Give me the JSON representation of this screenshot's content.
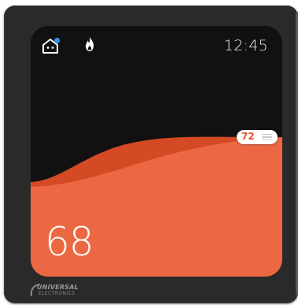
{
  "status_bar": {
    "time": "12:45",
    "home_icon": "home-robot-icon",
    "home_status_dot_color": "#2f8fe6",
    "mode_icon": "flame-icon"
  },
  "thermostat": {
    "current_temperature": "68",
    "setpoint_temperature": "72",
    "accent_color": "#ec6843",
    "accent_dark_color": "#d44a24"
  },
  "brand": {
    "name": "UNIVERSAL",
    "subname": "ELECTRONICS"
  }
}
